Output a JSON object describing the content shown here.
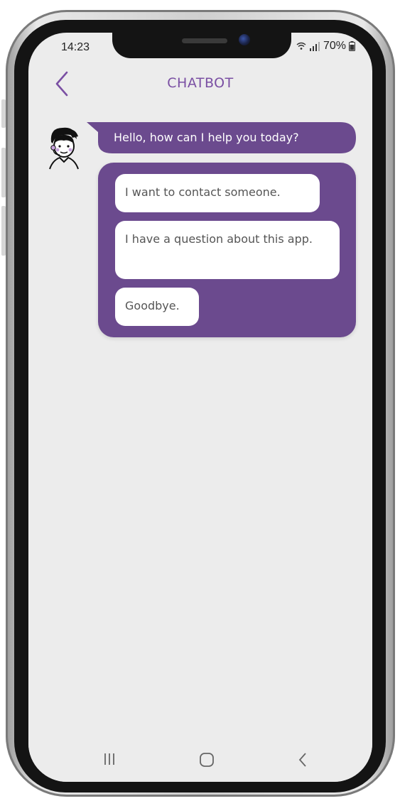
{
  "status_bar": {
    "time": "14:23",
    "battery": "70%"
  },
  "header": {
    "title": "CHATBOT",
    "back_icon": "chevron-left-icon"
  },
  "chat": {
    "bot_message": "Hello, how can I help you today?",
    "options": [
      {
        "label": "I want to contact someone."
      },
      {
        "label": "I have a question about this app."
      },
      {
        "label": "Goodbye."
      }
    ]
  },
  "nav_bar": {
    "items": [
      "recent-apps-icon",
      "home-icon",
      "back-icon"
    ]
  },
  "colors": {
    "accent": "#7a4fa3",
    "bubble": "#6b4a8e",
    "screen_bg": "#ececec"
  }
}
